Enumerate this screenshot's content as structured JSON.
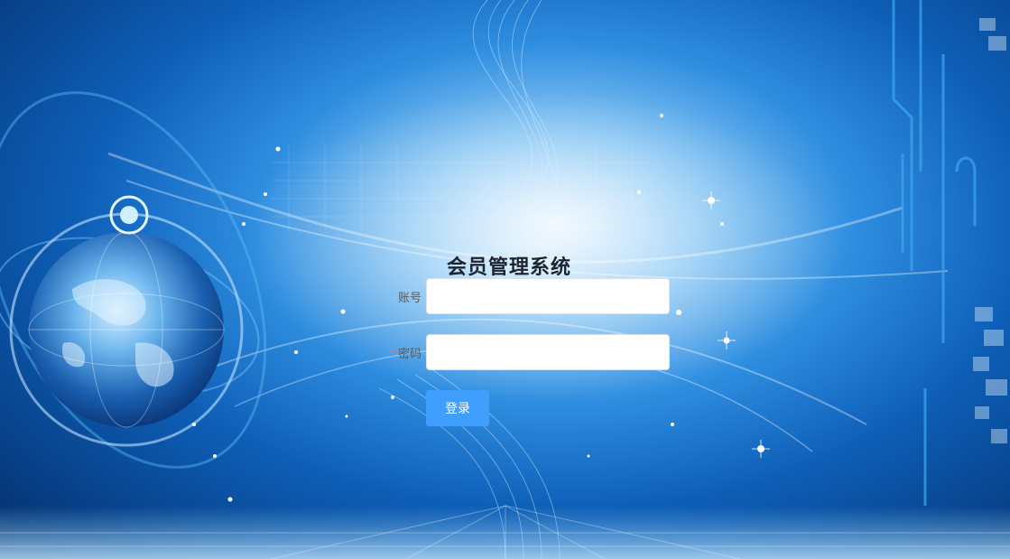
{
  "app": {
    "title": "会员管理系统"
  },
  "form": {
    "account_label": "账号",
    "account_value": "",
    "password_required_mark": "*",
    "password_label": "密码",
    "password_value": "",
    "submit_label": "登录"
  },
  "colors": {
    "primary_button": "#409eff",
    "required_mark": "#f56c6c",
    "background_blue": "#0e5fb8"
  }
}
